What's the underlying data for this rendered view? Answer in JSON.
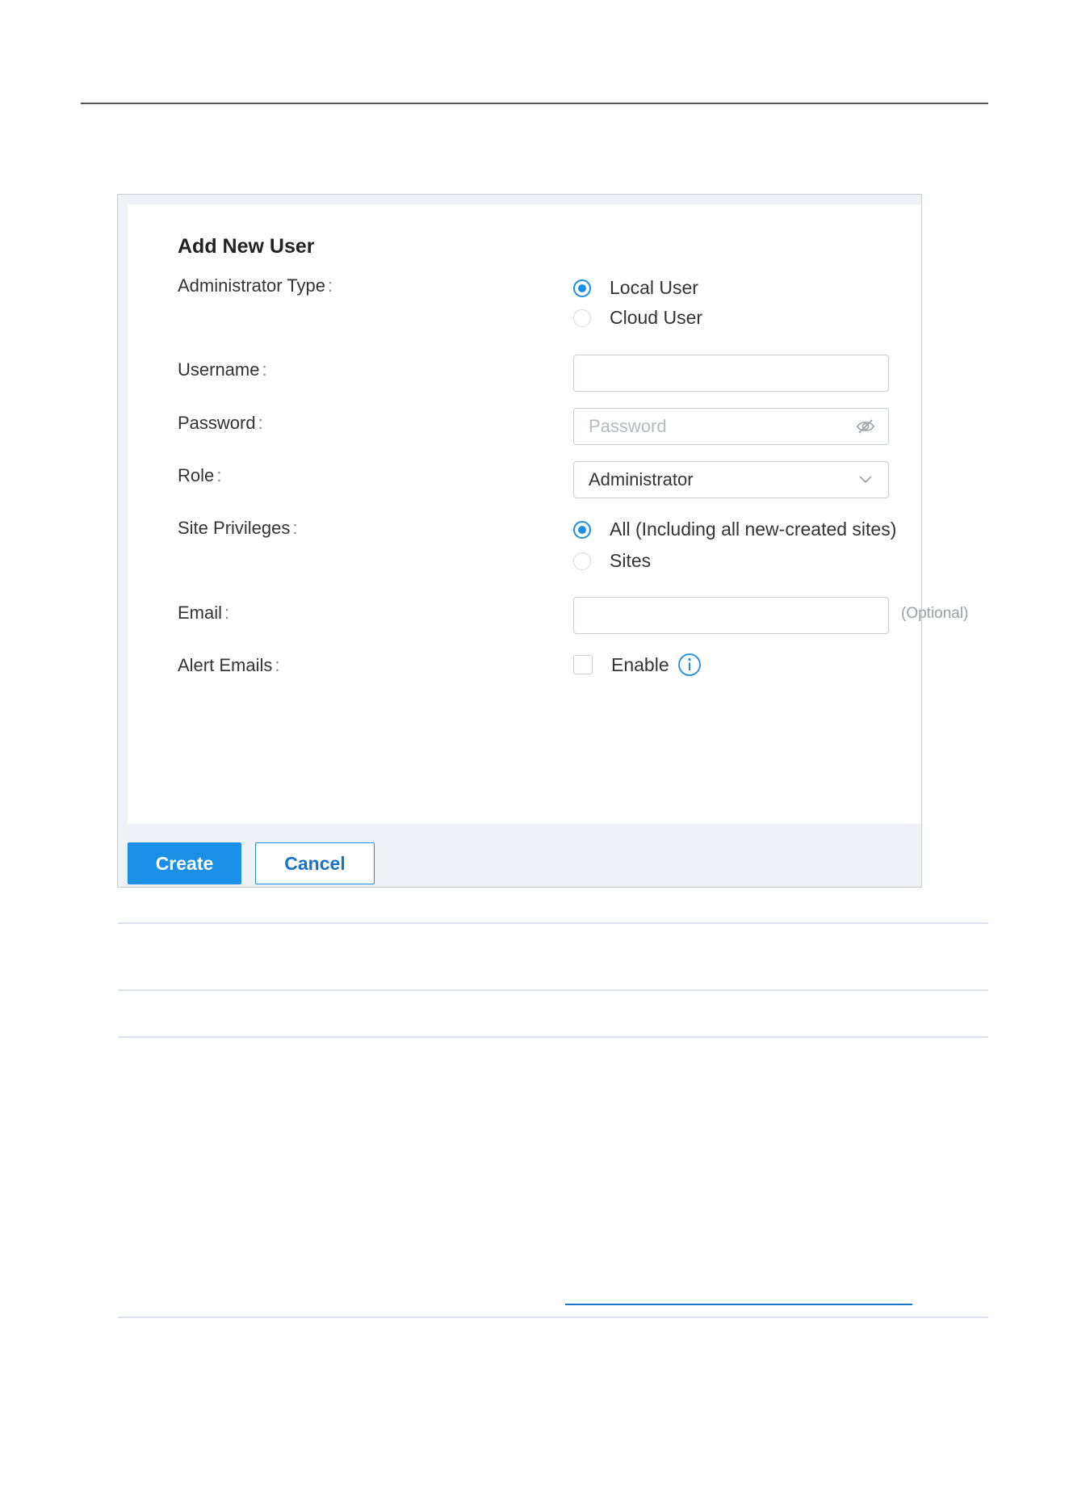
{
  "dialog": {
    "title": "Add New User",
    "fields": {
      "admin_type": {
        "label": "Administrator Type",
        "options": [
          "Local User",
          "Cloud User"
        ],
        "selected": "Local User"
      },
      "username": {
        "label": "Username",
        "value": ""
      },
      "password": {
        "label": "Password",
        "placeholder": "Password",
        "icon": "eye-off-icon"
      },
      "role": {
        "label": "Role",
        "value": "Administrator",
        "icon": "chevron-down-icon"
      },
      "site_privileges": {
        "label": "Site Privileges",
        "options": [
          "All (Including all new-created sites)",
          "Sites"
        ],
        "selected": "All (Including all new-created sites)"
      },
      "email": {
        "label": "Email",
        "value": "",
        "hint": "(Optional)"
      },
      "alert_emails": {
        "label": "Alert Emails",
        "checkbox_label": "Enable",
        "checked": false,
        "icon": "info-icon"
      }
    },
    "buttons": {
      "create": "Create",
      "cancel": "Cancel"
    },
    "colon": ":"
  },
  "colors": {
    "accent": "#1a8fe6",
    "border": "#c9ced6",
    "footer_bg": "#eef1f5"
  }
}
